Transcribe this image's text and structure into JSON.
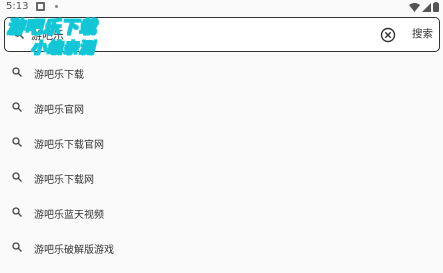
{
  "status_bar": {
    "time": "5:13",
    "icons": [
      "notification-icon",
      "dot-icon",
      "wifi-icon",
      "signal-icon",
      "battery-icon"
    ]
  },
  "search": {
    "query": "游吧乐",
    "submit_label": "搜索",
    "icon": "search-icon",
    "clear_icon": "clear-icon"
  },
  "watermark": {
    "line1": "游吧乐下载",
    "line2": "小编亲测",
    "color": "#12c6d6"
  },
  "suggestions": [
    {
      "label": "游吧乐下载",
      "icon": "search-icon"
    },
    {
      "label": "游吧乐官网",
      "icon": "search-icon"
    },
    {
      "label": "游吧乐下载官网",
      "icon": "search-icon"
    },
    {
      "label": "游吧乐下载网",
      "icon": "search-icon"
    },
    {
      "label": "游吧乐蓝天视频",
      "icon": "search-icon"
    },
    {
      "label": "游吧乐破解版游戏",
      "icon": "search-icon"
    }
  ]
}
